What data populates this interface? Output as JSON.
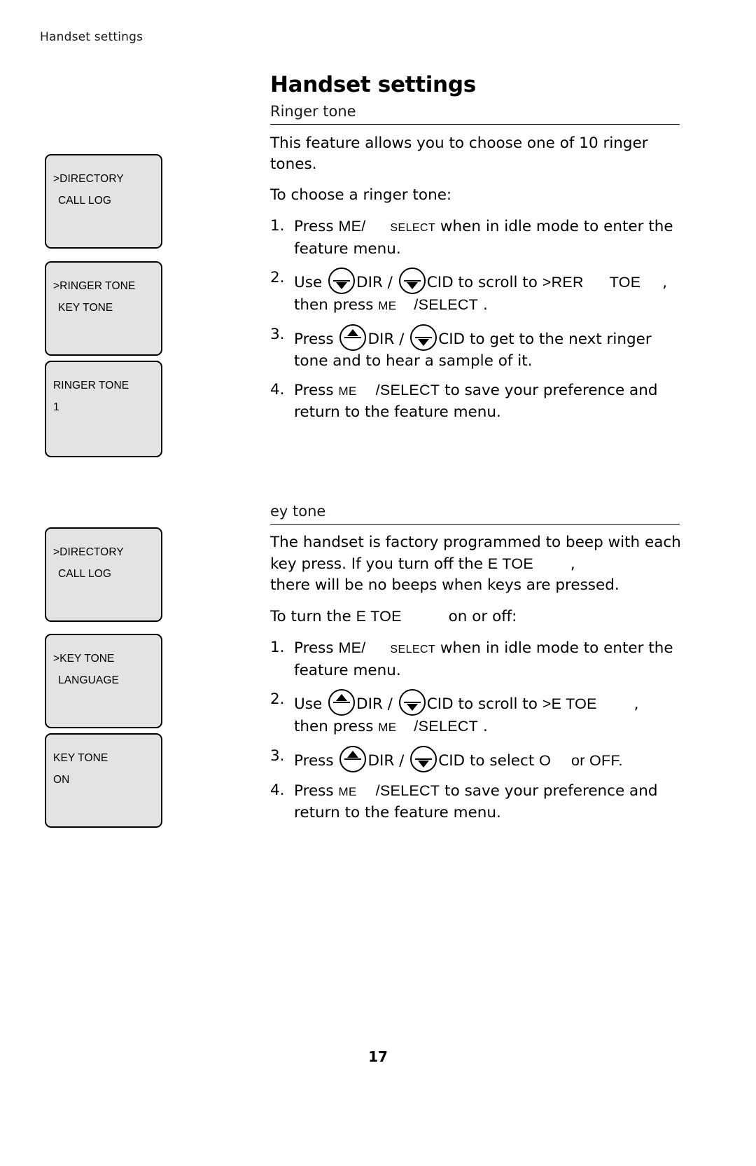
{
  "header": {
    "running_title": "Handset settings",
    "page_title": "Handset settings"
  },
  "sections": {
    "ringer": {
      "heading": "Ringer tone",
      "intro": "This feature allows you to choose one of 10 ringer tones.",
      "lead": "To choose a ringer tone:",
      "steps": [
        {
          "num": "1.",
          "a": "Press",
          "b": "ME",
          "c": "/",
          "d": "SELECT",
          "e": "when in idle mode to enter the feature menu."
        },
        {
          "num": "2.",
          "a": "Use",
          "b": "DIR /",
          "c": "CID",
          "d": "to scroll to",
          "e": ">R",
          "f": "ER",
          "g": "TOE",
          "h": ",",
          "i": "then press",
          "j": "ME",
          "k": "/SELECT",
          "l": "."
        },
        {
          "num": "3.",
          "a": "Press",
          "b": "DIR /",
          "c": "CID",
          "d": "to get to the next ringer tone and to hear a sample of it."
        },
        {
          "num": "4.",
          "a": "Press",
          "b": "ME",
          "c": "/SELECT",
          "d": "to save your preference and return to the feature menu."
        }
      ]
    },
    "key": {
      "heading": "ey tone",
      "intro_a": "The handset is factory programmed to beep with each key press. If you turn off the",
      "intro_b": "E TOE",
      "intro_c": ",",
      "intro_d": "there will be no beeps when keys are pressed.",
      "lead_a": "To turn the",
      "lead_b": "E TOE",
      "lead_c": "on or off:",
      "steps": [
        {
          "num": "1.",
          "a": "Press",
          "b": "ME",
          "c": "/",
          "d": "SELECT",
          "e": "when in idle mode to enter the feature menu."
        },
        {
          "num": "2.",
          "a": "Use",
          "b": "DIR /",
          "c": "CID",
          "d": "to scroll to",
          "e": ">E TOE",
          "f": ",",
          "g": "then press",
          "h": "ME",
          "i": "/SELECT",
          "j": "."
        },
        {
          "num": "3.",
          "a": "Press",
          "b": "DIR /",
          "c": "CID",
          "d": "to select",
          "e": "O",
          "f": "or OFF."
        },
        {
          "num": "4.",
          "a": "Press",
          "b": "ME",
          "c": "/SELECT",
          "d": "to save your preference and return to the feature menu."
        }
      ]
    }
  },
  "lcd_screens": [
    {
      "line1": ">DIRECTORY",
      "line2": "CALL LOG"
    },
    {
      "line1": ">RINGER TONE",
      "line2": "KEY TONE"
    },
    {
      "line1": "RINGER TONE",
      "line2": "1"
    },
    {
      "line1": ">DIRECTORY",
      "line2": "CALL LOG"
    },
    {
      "line1": ">KEY TONE",
      "line2": "LANGUAGE"
    },
    {
      "line1": "KEY TONE",
      "line2": "ON"
    }
  ],
  "footer": {
    "page_number": "17"
  }
}
